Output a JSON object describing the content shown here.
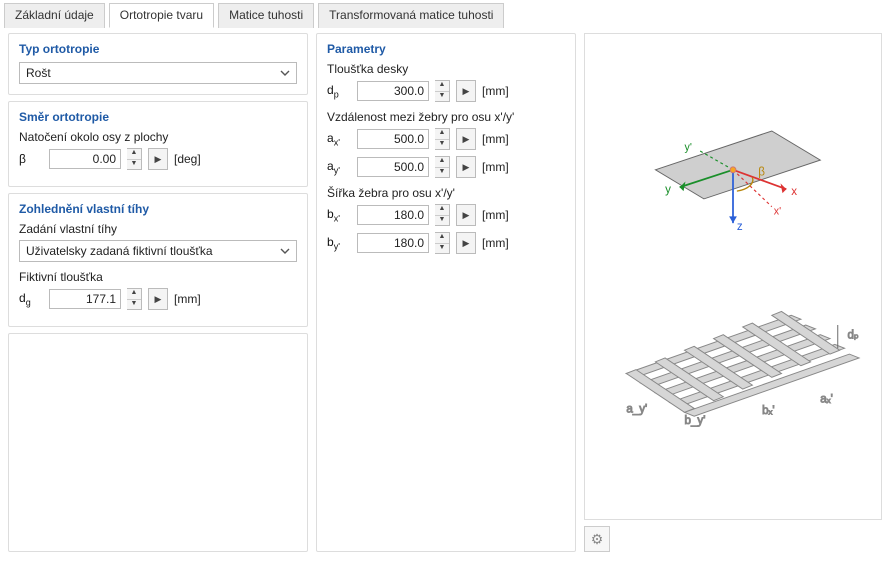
{
  "tabs": {
    "t0": "Základní údaje",
    "t1": "Ortotropie tvaru",
    "t2": "Matice tuhosti",
    "t3": "Transformovaná matice tuhosti"
  },
  "left": {
    "type_title": "Typ ortotropie",
    "type_value": "Rošt",
    "dir_title": "Směr ortotropie",
    "rotation_label": "Natočení okolo osy z plochy",
    "beta_sym": "β",
    "beta_val": "0.00",
    "deg_unit": "[deg]",
    "sw_title": "Zohlednění vlastní tíhy",
    "sw_method_label": "Zadání vlastní tíhy",
    "sw_method_value": "Uživatelsky zadaná fiktivní tloušťka",
    "fict_label": "Fiktivní tloušťka",
    "dg_sym_main": "d",
    "dg_sym_sub": "g",
    "dg_val": "177.1",
    "mm_unit": "[mm]"
  },
  "mid": {
    "params_title": "Parametry",
    "thick_label": "Tloušťka desky",
    "dp_sym_main": "d",
    "dp_sym_sub": "p",
    "dp_val": "300.0",
    "rib_dist_label": "Vzdálenost mezi žebry pro osu x'/y'",
    "ax_sym_main": "a",
    "ax_sym_sub": "x'",
    "ax_val": "500.0",
    "ay_sym_main": "a",
    "ay_sym_sub": "y'",
    "ay_val": "500.0",
    "rib_width_label": "Šířka žebra pro osu x'/y'",
    "bx_sym_main": "b",
    "bx_sym_sub": "x'",
    "bx_val": "180.0",
    "by_sym_main": "b",
    "by_sym_sub": "y'",
    "by_val": "180.0",
    "mm_unit": "[mm]"
  },
  "preview": {
    "ax_y": "y",
    "ax_yp": "y'",
    "ax_x": "x",
    "ax_xp": "x'",
    "ax_z": "z",
    "ax_beta": "β",
    "lab_dp": "dₚ",
    "lab_ax": "aₓ'",
    "lab_ay": "a_y'",
    "lab_bx": "bₓ'",
    "lab_by": "b_y'"
  }
}
